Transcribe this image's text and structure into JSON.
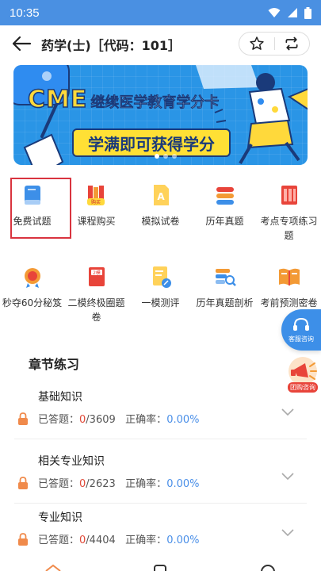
{
  "status_bar": {
    "time": "10:35"
  },
  "header": {
    "title": "药学(士)［代码：101］"
  },
  "banner": {
    "title_en": "CME",
    "title_cn": "继续医学教育学分卡",
    "slogan": "学满即可获得学分"
  },
  "menu_row1": [
    {
      "label": "免费试题",
      "icon": "book-icon"
    },
    {
      "label": "课程购买",
      "icon": "books-purchase-icon"
    },
    {
      "label": "模拟试卷",
      "icon": "paper-a-icon"
    },
    {
      "label": "历年真题",
      "icon": "stacked-papers-icon"
    },
    {
      "label": "考点专项练习题",
      "icon": "archive-icon"
    }
  ],
  "menu_row2": [
    {
      "label": "秒夺60分秘笈",
      "icon": "medal-icon"
    },
    {
      "label": "二模终极圈题卷",
      "icon": "exam-book-icon"
    },
    {
      "label": "一模测评",
      "icon": "edit-note-icon"
    },
    {
      "label": "历年真题剖析",
      "icon": "search-paper-icon"
    },
    {
      "label": "考前预测密卷",
      "icon": "open-book-icon"
    }
  ],
  "floating": {
    "service_label": "客服咨询",
    "group_label": "团购咨询"
  },
  "section": {
    "title": "章节练习"
  },
  "chapters": [
    {
      "title": "基础知识",
      "answered_label": "已答题：",
      "answered": "0",
      "total": "/3609",
      "accuracy_label": "正确率：",
      "accuracy": "0.00%"
    },
    {
      "title": "相关专业知识",
      "answered_label": "已答题：",
      "answered": "0",
      "total": "/2623",
      "accuracy_label": "正确率：",
      "accuracy": "0.00%"
    },
    {
      "title": "专业知识",
      "answered_label": "已答题：",
      "answered": "0",
      "total": "/4404",
      "accuracy_label": "正确率：",
      "accuracy": "0.00%"
    }
  ],
  "colors": {
    "status_bar": "#4a90e2",
    "accent_blue": "#4a8fe8",
    "red": "#e04b3a",
    "highlight": "#d9343f"
  }
}
